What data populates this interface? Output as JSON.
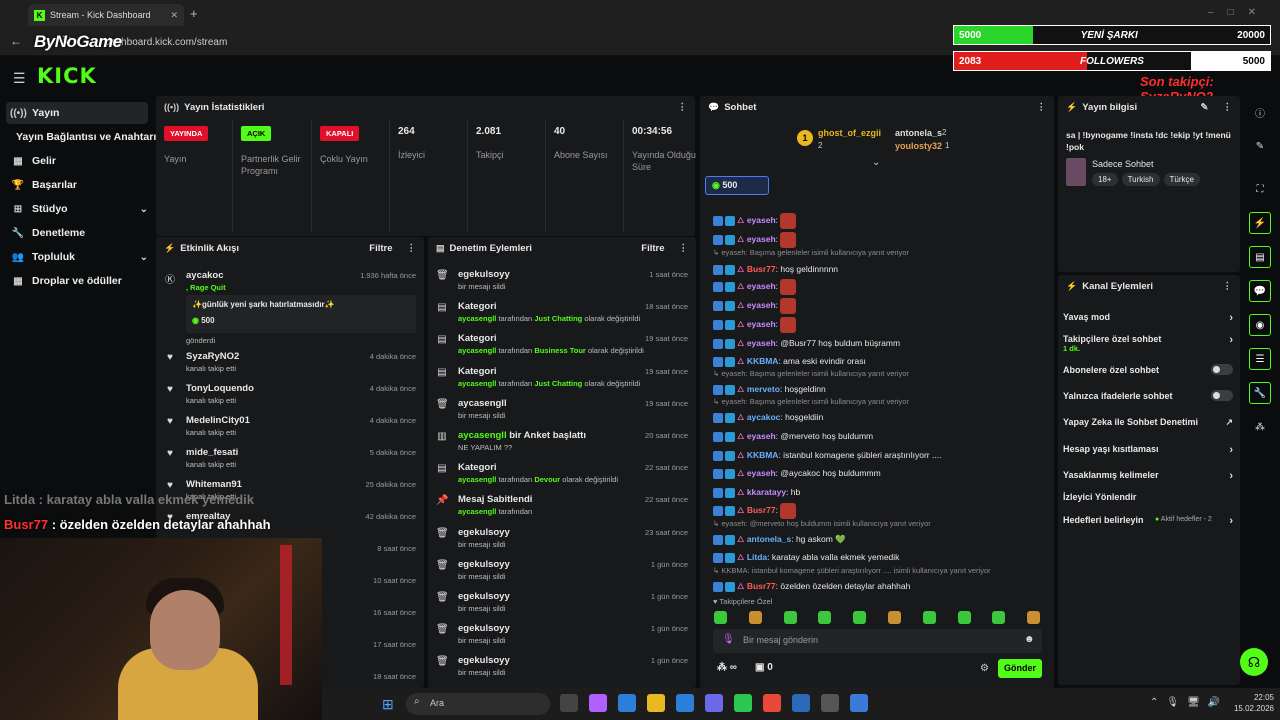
{
  "browser": {
    "tab_title": "Stream - Kick Dashboard",
    "url": "dashboard.kick.com/stream",
    "overlay_logo": "ByNoGame"
  },
  "kick_logo": "KICK",
  "overlay": {
    "bar1": {
      "left": "5000",
      "mid": "YENİ ŞARKI",
      "right": "20000",
      "color": "#2bd62b",
      "fraction": 0.25
    },
    "bar2": {
      "left": "2083",
      "mid": "FOLLOWERS",
      "right": "5000",
      "color": "#e01e1e",
      "fraction": 0.42
    },
    "son_takip": "Son takipçi: SyzaRyNO2",
    "chat_line1": "Litda : karatay abla valla ekmek yemedik",
    "chat_line2_user": "Busr77",
    "chat_line2_text": " : özelden özelden detaylar ahahhah"
  },
  "nav": {
    "items": [
      {
        "label": "Yayın",
        "icon": "((•))"
      },
      {
        "label": "Yayın Bağlantısı ve Anahtarı",
        "icon": ""
      },
      {
        "label": "Gelir",
        "icon": "▦"
      },
      {
        "label": "Başarılar",
        "icon": "🏆"
      },
      {
        "label": "Stüdyo",
        "icon": "⊞"
      },
      {
        "label": "Denetleme",
        "icon": "🔧"
      },
      {
        "label": "Topluluk",
        "icon": "👥"
      },
      {
        "label": "Droplar ve ödüller",
        "icon": "▦"
      }
    ]
  },
  "stats": {
    "title": "Yayın İstatistikleri",
    "items": [
      {
        "badge": "YAYINDA",
        "label": "Yayın",
        "badge_color": "#e0102a",
        "text_color": "#fff"
      },
      {
        "badge": "AÇIK",
        "label": "Partnerlik Gelir Programı",
        "badge_color": "#53fc18",
        "text_color": "#000"
      },
      {
        "badge": "KAPALI",
        "label": "Çoklu Yayın",
        "badge_color": "#e0102a",
        "text_color": "#fff"
      },
      {
        "value": "264",
        "label": "İzleyici"
      },
      {
        "value": "2.081",
        "label": "Takipçi"
      },
      {
        "value": "40",
        "label": "Abone Sayısı"
      },
      {
        "value": "00:34:56",
        "label": "Yayında Olduğu Süre"
      }
    ]
  },
  "activity": {
    "title": "Etkinlik Akışı",
    "filter": "Filtre",
    "first": {
      "name": "aycakoc",
      "game": ", Rage Quit",
      "time": "1.936 hafta önce",
      "message": "✨günlük yeni şarkı hatırlatmasıdır✨",
      "amount": "500",
      "footer": "gönderdi"
    },
    "rows": [
      {
        "name": "SyzaRyNO2",
        "sub": "kanalı takip etti",
        "time": "4 dakika önce"
      },
      {
        "name": "TonyLoquendo",
        "sub": "kanalı takip etti",
        "time": "4 dakika önce"
      },
      {
        "name": "MedelinCity01",
        "sub": "kanalı takip etti",
        "time": "4 dakika önce"
      },
      {
        "name": "mide_fesati",
        "sub": "kanalı takip etti",
        "time": "5 dakika önce"
      },
      {
        "name": "Whiteman91",
        "sub": "kanalı takip etti",
        "time": "25 dakika önce"
      },
      {
        "name": "emrealtay",
        "sub": "",
        "time": "42 dakika önce"
      },
      {
        "name": "",
        "sub": "",
        "time": "8 saat önce"
      },
      {
        "name": "",
        "sub": "",
        "time": "10 saat önce"
      },
      {
        "name": "",
        "sub": "",
        "time": "16 saat önce"
      },
      {
        "name": "",
        "sub": "",
        "time": "17 saat önce"
      },
      {
        "name": "",
        "sub": "",
        "time": "18 saat önce"
      }
    ]
  },
  "moderation": {
    "title": "Denetim Eylemleri",
    "filter": "Filtre",
    "rows": [
      {
        "icon": "🗑",
        "title": "egekulsoyy",
        "sub_user": "",
        "sub": "bir mesajı sildi",
        "time": "1 saat önce"
      },
      {
        "icon": "▤",
        "title": "Kategori",
        "sub_user": "aycasengll",
        "sub_mid": " tarafından ",
        "sub_cat": "Just Chatting",
        "sub_end": " olarak değiştirildi",
        "time": "18 saat önce"
      },
      {
        "icon": "▤",
        "title": "Kategori",
        "sub_user": "aycasengll",
        "sub_mid": " tarafından ",
        "sub_cat": "Business Tour",
        "sub_end": " olarak değiştirildi",
        "time": "19 saat önce"
      },
      {
        "icon": "▤",
        "title": "Kategori",
        "sub_user": "aycasengll",
        "sub_mid": " tarafından ",
        "sub_cat": "Just Chatting",
        "sub_end": " olarak değiştirildi",
        "time": "19 saat önce"
      },
      {
        "icon": "🗑",
        "title": "aycasengll",
        "sub_user": "",
        "sub": "bir mesajı sildi",
        "time": "19 saat önce"
      },
      {
        "icon": "▥",
        "title_user": "aycasengll",
        "title": " bir Anket başlattı",
        "sub_user": "",
        "sub": "NE YAPALIM ??",
        "time": "20 saat önce"
      },
      {
        "icon": "▤",
        "title": "Kategori",
        "sub_user": "aycasengll",
        "sub_mid": " tarafından ",
        "sub_cat": "Devour",
        "sub_end": " olarak değiştirildi",
        "time": "22 saat önce"
      },
      {
        "icon": "📌",
        "title": "Mesaj Sabitlendi",
        "sub_user": "aycasengll",
        "sub_mid": " tarafından",
        "time": "22 saat önce"
      },
      {
        "icon": "🗑",
        "title": "egekulsoyy",
        "sub_user": "",
        "sub": "bir mesajı sildi",
        "time": "23 saat önce"
      },
      {
        "icon": "🗑",
        "title": "egekulsoyy",
        "sub_user": "",
        "sub": "bir mesajı sildi",
        "time": "1 gün önce"
      },
      {
        "icon": "🗑",
        "title": "egekulsoyy",
        "sub_user": "",
        "sub": "bir mesajı sildi",
        "time": "1 gün önce"
      },
      {
        "icon": "🗑",
        "title": "egekulsoyy",
        "sub_user": "",
        "sub": "bir mesajı sildi",
        "time": "1 gün önce"
      },
      {
        "icon": "🗑",
        "title": "egekulsoyy",
        "sub_user": "",
        "sub": "bir mesajı sildi",
        "time": "1 gün önce"
      }
    ]
  },
  "chat": {
    "title": "Sohbet",
    "top_gifters": [
      {
        "name": "ghost_of_ezgii",
        "count": "2"
      },
      {
        "name": "antonela_s",
        "count": "2"
      },
      {
        "name": "youlosty32",
        "count": "1"
      }
    ],
    "rank": "1",
    "kicks": "500",
    "messages": [
      {
        "user": "eyaseh",
        "ucolor": "#c78cff",
        "text": ":",
        "emote": true
      },
      {
        "user": "eyaseh",
        "ucolor": "#c78cff",
        "text": ":",
        "emote": true
      },
      {
        "reply": "eyaseh: Başıma gelenleler isimli kullanıcıya yanıt veriyor"
      },
      {
        "user": "Busr77",
        "ucolor": "#ff5c5c",
        "text": ": hoş geldinnnnn"
      },
      {
        "user": "eyaseh",
        "ucolor": "#c78cff",
        "text": ":",
        "emote": true
      },
      {
        "user": "eyaseh",
        "ucolor": "#c78cff",
        "text": ":",
        "emote": true
      },
      {
        "user": "eyaseh",
        "ucolor": "#c78cff",
        "text": ":",
        "emote": true
      },
      {
        "user": "eyaseh",
        "ucolor": "#c78cff",
        "text": ": @Busr77 hoş buldum büşramm"
      },
      {
        "user": "KKBMA",
        "ucolor": "#6ab0ff",
        "text": ": ama eski evindir orası"
      },
      {
        "reply": "eyaseh: Başıma gelenleler isimli kullanıcıya yanıt veriyor"
      },
      {
        "user": "merveto",
        "ucolor": "#6ab0ff",
        "text": ": hoşgeldinn"
      },
      {
        "reply": "eyaseh: Başıma gelenleler isimli kullanıcıya yanıt veriyor"
      },
      {
        "user": "aycakoc",
        "ucolor": "#6ab0ff",
        "text": ": hoşgeldiin"
      },
      {
        "user": "eyaseh",
        "ucolor": "#c78cff",
        "text": ": @merveto hoş buldumm"
      },
      {
        "user": "KKBMA",
        "ucolor": "#6ab0ff",
        "text": ": istanbul komagene şübleri araştırılıyorr ...."
      },
      {
        "user": "eyaseh",
        "ucolor": "#c78cff",
        "text": ": @aycakoc hoş buldummm"
      },
      {
        "user": "kkaratayy",
        "ucolor": "#c78cff",
        "text": ": hb"
      },
      {
        "user": "Busr77",
        "ucolor": "#ff5c5c",
        "text": ":",
        "emote": true
      },
      {
        "reply": "eyaseh: @merveto hoş buldumm isimli kullanıcıya yanıt veriyor"
      },
      {
        "user": "antonela_s",
        "ucolor": "#6ab0ff",
        "text": ": hg askom 💚"
      },
      {
        "user": "Litda",
        "ucolor": "#6ab0ff",
        "text": ": karatay abla valla ekmek yemedik"
      },
      {
        "reply": "KKBMA: istanbul komagene şübleri araştırılıyorr .... isimli kullanıcıya yanıt veriyor"
      },
      {
        "user": "Busr77",
        "ucolor": "#ff5c5c",
        "text": ": özelden özelden detaylar ahahhah"
      }
    ],
    "followers_only": "Takipçilere Özel",
    "placeholder": "Bir mesaj gönderin",
    "infinity": "∞",
    "count": "0",
    "send": "Gönder"
  },
  "stream_info": {
    "title": "Yayın bilgisi",
    "text": "sa | !bynogame !insta !dc !ekip !yt !menü !pok",
    "category": "Sadece Sohbet",
    "tags": [
      "18+",
      "Turkish",
      "Türkçe"
    ]
  },
  "channel_actions": {
    "title": "Kanal Eylemleri",
    "items": [
      {
        "label": "Yavaş mod",
        "type": "chev"
      },
      {
        "label": "Takipçilere özel sohbet",
        "sub": "1 dk.",
        "type": "chev"
      },
      {
        "label": "Abonelere özel sohbet",
        "type": "toggle"
      },
      {
        "label": "Yalnızca ifadelerle sohbet",
        "type": "toggle"
      },
      {
        "label": "Yapay Zeka ile Sohbet Denetimi",
        "type": "ext"
      },
      {
        "label": "Hesap yaşı kısıtlaması",
        "type": "chev"
      },
      {
        "label": "Yasaklanmış kelimeler",
        "type": "chev"
      },
      {
        "label": "İzleyici Yönlendir",
        "type": "none"
      },
      {
        "label": "Hedefleri belirleyin",
        "badge": "Aktif hedefler - 2",
        "type": "chev"
      }
    ]
  },
  "taskbar": {
    "search": "Ara",
    "time": "22:05",
    "date": "15.02.2026"
  },
  "colors": {
    "accent": "#53fc18",
    "live": "#e0102a"
  }
}
